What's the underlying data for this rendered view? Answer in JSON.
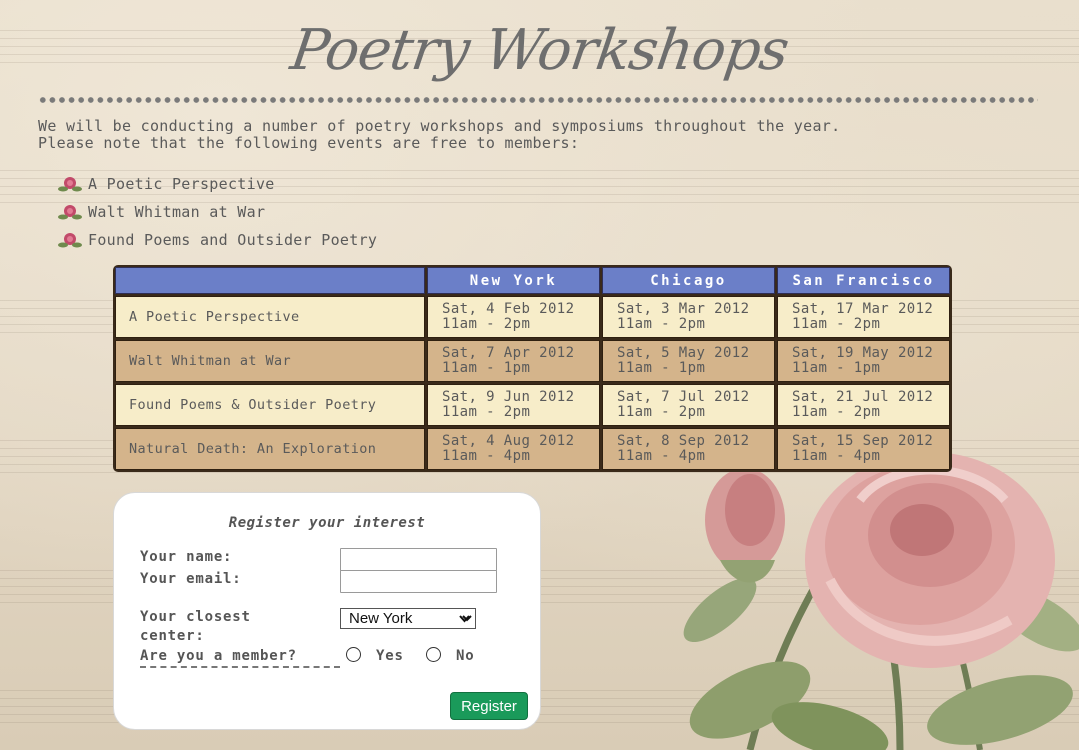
{
  "page": {
    "title": "Poetry Workshops",
    "intro_line1": "We will be conducting a number of poetry workshops and symposiums throughout the year.",
    "intro_line2": "Please note that the following events are free to members:"
  },
  "bullets": [
    {
      "label": "A Poetic Perspective",
      "icon": "rose-bullet-icon"
    },
    {
      "label": "Walt Whitman at War",
      "icon": "rose-bullet-icon"
    },
    {
      "label": "Found Poems and Outsider Poetry",
      "icon": "rose-bullet-icon"
    }
  ],
  "schedule": {
    "headers": [
      "",
      "New York",
      "Chicago",
      "San Francisco"
    ],
    "rows": [
      {
        "event": "A Poetic Perspective",
        "dates": [
          [
            "Sat, 4 Feb 2012",
            "11am - 2pm"
          ],
          [
            "Sat, 3 Mar 2012",
            "11am - 2pm"
          ],
          [
            "Sat, 17 Mar 2012",
            "11am - 2pm"
          ]
        ]
      },
      {
        "event": "Walt Whitman at War",
        "dates": [
          [
            "Sat, 7 Apr 2012",
            "11am - 1pm"
          ],
          [
            "Sat, 5 May 2012",
            "11am - 1pm"
          ],
          [
            "Sat, 19 May 2012",
            "11am - 1pm"
          ]
        ]
      },
      {
        "event": "Found Poems & Outsider Poetry",
        "dates": [
          [
            "Sat, 9 Jun 2012",
            "11am - 2pm"
          ],
          [
            "Sat, 7 Jul 2012",
            "11am - 2pm"
          ],
          [
            "Sat, 21 Jul 2012",
            "11am - 2pm"
          ]
        ]
      },
      {
        "event": "Natural Death: An Exploration",
        "dates": [
          [
            "Sat, 4 Aug 2012",
            "11am - 4pm"
          ],
          [
            "Sat, 8 Sep 2012",
            "11am - 4pm"
          ],
          [
            "Sat, 15 Sep 2012",
            "11am - 4pm"
          ]
        ]
      }
    ]
  },
  "form": {
    "title": "Register your interest",
    "name_label": "Your name:",
    "name_value": "",
    "email_label": "Your email:",
    "email_value": "",
    "center_label_line1": "Your closest",
    "center_label_line2": "center:",
    "center_selected": "New York",
    "member_label": "Are you a member?",
    "yes_label": "Yes",
    "no_label": "No",
    "submit_label": "Register"
  },
  "colors": {
    "header_blue": "#6b7fc8",
    "row_light": "#f7edc9",
    "row_dark": "#d4b48b",
    "button_green": "#1a9a5a"
  }
}
